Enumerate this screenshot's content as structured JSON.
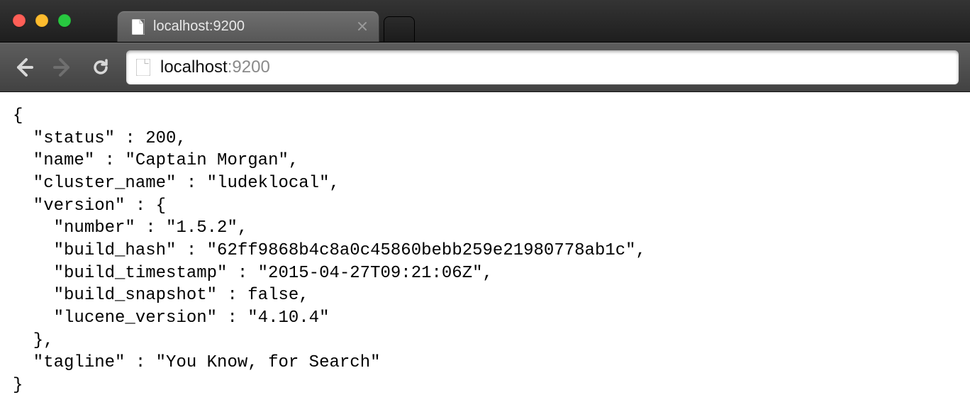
{
  "tab": {
    "title": "localhost:9200"
  },
  "address": {
    "host": "localhost",
    "port": ":9200"
  },
  "json": {
    "open": "{",
    "status_k": "  \"status\" : ",
    "status_v": "200,",
    "name_k": "  \"name\" : ",
    "name_v": "\"Captain Morgan\",",
    "cluster_k": "  \"cluster_name\" : ",
    "cluster_v": "\"ludeklocal\",",
    "ver_k": "  \"version\" : {",
    "number_k": "    \"number\" : ",
    "number_v": "\"1.5.2\",",
    "hash_k": "    \"build_hash\" : ",
    "hash_v": "\"62ff9868b4c8a0c45860bebb259e21980778ab1c\",",
    "ts_k": "    \"build_timestamp\" : ",
    "ts_v": "\"2015-04-27T09:21:06Z\",",
    "snap_k": "    \"build_snapshot\" : ",
    "snap_v": "false,",
    "luc_k": "    \"lucene_version\" : ",
    "luc_v": "\"4.10.4\"",
    "ver_close": "  },",
    "tag_k": "  \"tagline\" : ",
    "tag_v": "\"You Know, for Search\"",
    "close": "}"
  }
}
